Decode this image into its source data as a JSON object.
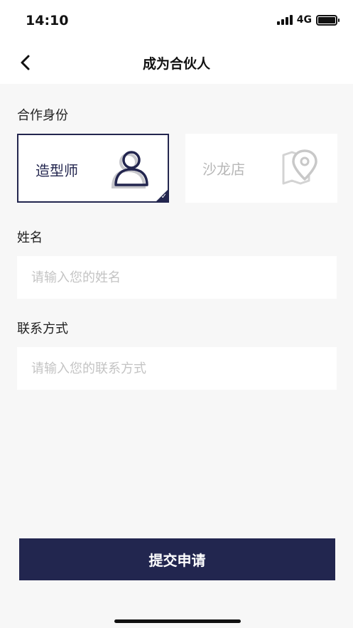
{
  "status_bar": {
    "time": "14:10",
    "network": "4G",
    "icons": [
      "signal-icon",
      "battery-icon"
    ]
  },
  "nav": {
    "title": "成为合伙人",
    "back_icon": "chevron-left-icon"
  },
  "role_section": {
    "label": "合作身份",
    "options": [
      {
        "label": "造型师",
        "icon": "person-icon",
        "selected": true
      },
      {
        "label": "沙龙店",
        "icon": "location-pin-icon",
        "selected": false
      }
    ],
    "check_icon": "checkmark-icon"
  },
  "name_section": {
    "label": "姓名",
    "value": "",
    "placeholder": "请输入您的姓名"
  },
  "contact_section": {
    "label": "联系方式",
    "value": "",
    "placeholder": "请输入您的联系方式"
  },
  "submit": {
    "label": "提交申请"
  },
  "colors": {
    "accent": "#22264f",
    "background": "#f7f7f7",
    "placeholder": "#c4c4c4",
    "unselected_text": "#b7b7b7"
  }
}
